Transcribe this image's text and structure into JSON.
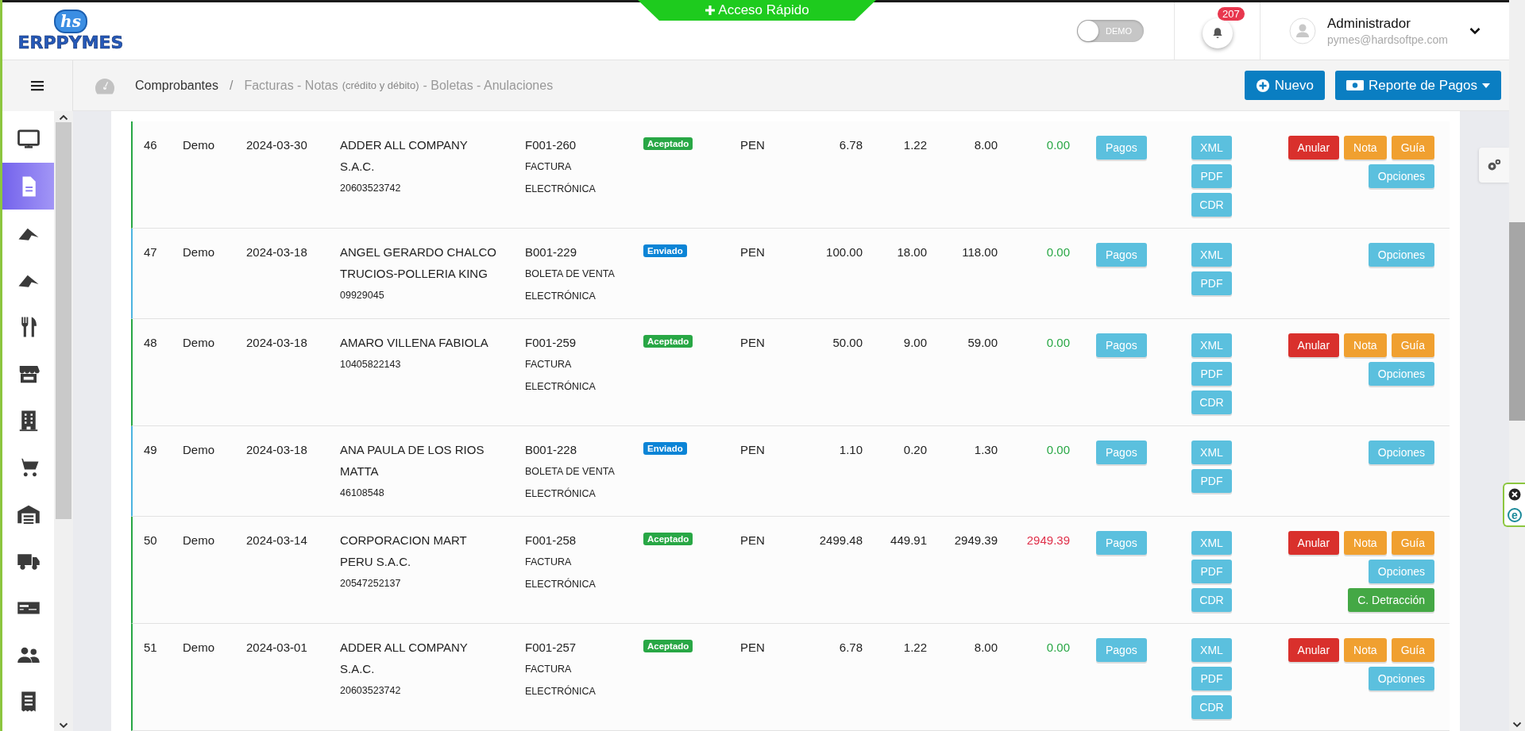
{
  "header": {
    "logo_badge": "hs",
    "logo_text": "ERPPYMES",
    "quick_access": "Acceso Rápido",
    "demo_toggle": {
      "label": "DEMO",
      "on": false
    },
    "notifications": {
      "count": "207"
    },
    "user": {
      "name": "Administrador",
      "email": "pymes@hardsoftpe.com"
    }
  },
  "sidebar": {
    "items": [
      {
        "kind": "monitor",
        "selected": false
      },
      {
        "kind": "document",
        "selected": true
      },
      {
        "kind": "peak",
        "selected": false
      },
      {
        "kind": "peak",
        "selected": false
      },
      {
        "kind": "cutlery",
        "selected": false
      },
      {
        "kind": "store",
        "selected": false
      },
      {
        "kind": "building",
        "selected": false
      },
      {
        "kind": "cart",
        "selected": false
      },
      {
        "kind": "garage",
        "selected": false
      },
      {
        "kind": "truck",
        "selected": false
      },
      {
        "kind": "card",
        "selected": false
      },
      {
        "kind": "users",
        "selected": false
      },
      {
        "kind": "receipt",
        "selected": false
      }
    ]
  },
  "breadcrumb": {
    "section": "Comprobantes",
    "separator": "/",
    "page": "Facturas - Notas",
    "page_note": "(crédito y débito)",
    "page_rest": "- Boletas - Anulaciones"
  },
  "toolbar": {
    "buttons": [
      {
        "label": "Nuevo",
        "kind": "new"
      },
      {
        "label": "Reporte de Pagos",
        "kind": "dropdown"
      }
    ]
  },
  "rows": [
    {
      "number": "46",
      "user": "Demo",
      "date": "2024-03-30",
      "customer": "ADDER ALL COMPANY S.A.C.",
      "customer_id": "20603523742",
      "doc_number": "F001-260",
      "doc_type": "FACTURA ELECTRÓNICA",
      "status": {
        "label": "Aceptado",
        "kind": "accepted"
      },
      "currency": "PEN",
      "subtotal": "6.78",
      "igv": "1.22",
      "total": "8.00",
      "balance": {
        "text": "0.00",
        "kind": "paid"
      },
      "payments_button": "Pagos",
      "files": [
        "XML",
        "PDF",
        "CDR"
      ],
      "action_lines": [
        {
          "buttons": [
            {
              "label": "Anular",
              "kind": "danger"
            },
            {
              "label": "Nota",
              "kind": "warning"
            },
            {
              "label": "Guía",
              "kind": "warning"
            }
          ]
        },
        {
          "buttons": [
            {
              "label": "Opciones",
              "kind": "info"
            }
          ]
        }
      ]
    },
    {
      "number": "47",
      "user": "Demo",
      "date": "2024-03-18",
      "customer": "ANGEL GERARDO CHALCO TRUCIOS-POLLERIA KING",
      "customer_id": "09929045",
      "doc_number": "B001-229",
      "doc_type": "BOLETA DE VENTA ELECTRÓNICA",
      "status": {
        "label": "Enviado",
        "kind": "sent"
      },
      "currency": "PEN",
      "subtotal": "100.00",
      "igv": "18.00",
      "total": "118.00",
      "balance": {
        "text": "0.00",
        "kind": "paid"
      },
      "payments_button": "Pagos",
      "files": [
        "XML",
        "PDF"
      ],
      "action_lines": [
        {
          "buttons": [
            {
              "label": "Opciones",
              "kind": "info"
            }
          ]
        }
      ]
    },
    {
      "number": "48",
      "user": "Demo",
      "date": "2024-03-18",
      "customer": "AMARO VILLENA FABIOLA",
      "customer_id": "10405822143",
      "doc_number": "F001-259",
      "doc_type": "FACTURA ELECTRÓNICA",
      "status": {
        "label": "Aceptado",
        "kind": "accepted"
      },
      "currency": "PEN",
      "subtotal": "50.00",
      "igv": "9.00",
      "total": "59.00",
      "balance": {
        "text": "0.00",
        "kind": "paid"
      },
      "payments_button": "Pagos",
      "files": [
        "XML",
        "PDF",
        "CDR"
      ],
      "action_lines": [
        {
          "buttons": [
            {
              "label": "Anular",
              "kind": "danger"
            },
            {
              "label": "Nota",
              "kind": "warning"
            },
            {
              "label": "Guía",
              "kind": "warning"
            }
          ]
        },
        {
          "buttons": [
            {
              "label": "Opciones",
              "kind": "info"
            }
          ]
        }
      ]
    },
    {
      "number": "49",
      "user": "Demo",
      "date": "2024-03-18",
      "customer": "ANA PAULA DE LOS RIOS MATTA",
      "customer_id": "46108548",
      "doc_number": "B001-228",
      "doc_type": "BOLETA DE VENTA ELECTRÓNICA",
      "status": {
        "label": "Enviado",
        "kind": "sent"
      },
      "currency": "PEN",
      "subtotal": "1.10",
      "igv": "0.20",
      "total": "1.30",
      "balance": {
        "text": "0.00",
        "kind": "paid"
      },
      "payments_button": "Pagos",
      "files": [
        "XML",
        "PDF"
      ],
      "action_lines": [
        {
          "buttons": [
            {
              "label": "Opciones",
              "kind": "info"
            }
          ]
        }
      ]
    },
    {
      "number": "50",
      "user": "Demo",
      "date": "2024-03-14",
      "customer": "CORPORACION MART PERU S.A.C.",
      "customer_id": "20547252137",
      "doc_number": "F001-258",
      "doc_type": "FACTURA ELECTRÓNICA",
      "status": {
        "label": "Aceptado",
        "kind": "accepted"
      },
      "currency": "PEN",
      "subtotal": "2499.48",
      "igv": "449.91",
      "total": "2949.39",
      "balance": {
        "text": "2949.39",
        "kind": "due"
      },
      "payments_button": "Pagos",
      "files": [
        "XML",
        "PDF",
        "CDR"
      ],
      "action_lines": [
        {
          "buttons": [
            {
              "label": "Anular",
              "kind": "danger"
            },
            {
              "label": "Nota",
              "kind": "warning"
            },
            {
              "label": "Guía",
              "kind": "warning"
            }
          ]
        },
        {
          "buttons": [
            {
              "label": "Opciones",
              "kind": "info"
            }
          ]
        },
        {
          "buttons": [
            {
              "label": "C. Detracción",
              "kind": "success"
            }
          ]
        }
      ]
    },
    {
      "number": "51",
      "user": "Demo",
      "date": "2024-03-01",
      "customer": "ADDER ALL COMPANY S.A.C.",
      "customer_id": "20603523742",
      "doc_number": "F001-257",
      "doc_type": "FACTURA ELECTRÓNICA",
      "status": {
        "label": "Aceptado",
        "kind": "accepted"
      },
      "currency": "PEN",
      "subtotal": "6.78",
      "igv": "1.22",
      "total": "8.00",
      "balance": {
        "text": "0.00",
        "kind": "paid"
      },
      "payments_button": "Pagos",
      "files": [
        "XML",
        "PDF",
        "CDR"
      ],
      "action_lines": [
        {
          "buttons": [
            {
              "label": "Anular",
              "kind": "danger"
            },
            {
              "label": "Nota",
              "kind": "warning"
            },
            {
              "label": "Guía",
              "kind": "warning"
            }
          ]
        },
        {
          "buttons": [
            {
              "label": "Opciones",
              "kind": "info"
            }
          ]
        }
      ]
    }
  ],
  "floating_widget": {
    "label": "e"
  }
}
